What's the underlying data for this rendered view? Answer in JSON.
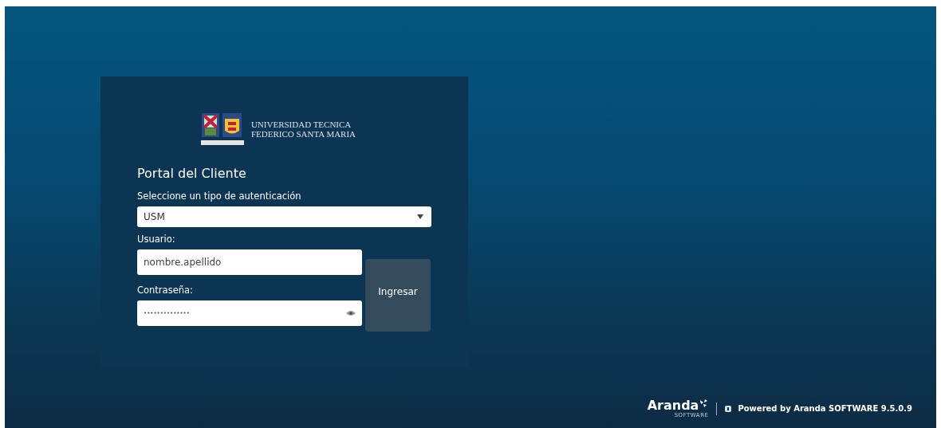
{
  "logo": {
    "line_1": "UNIVERSIDAD TECNICA",
    "line_2": "FEDERICO SANTA MARIA"
  },
  "title": "Portal del Cliente",
  "auth": {
    "label": "Seleccione un tipo de autenticación",
    "value": "USM"
  },
  "username": {
    "label": "Usuario:",
    "value": "nombre.apellido"
  },
  "password": {
    "label": "Contraseña:",
    "value": "••••••••••••••"
  },
  "submit": "Ingresar",
  "footer": {
    "brand": "Aranda",
    "brand_sub": "SOFTWARE",
    "powered": "Powered by Aranda SOFTWARE 9.5.0.9"
  }
}
